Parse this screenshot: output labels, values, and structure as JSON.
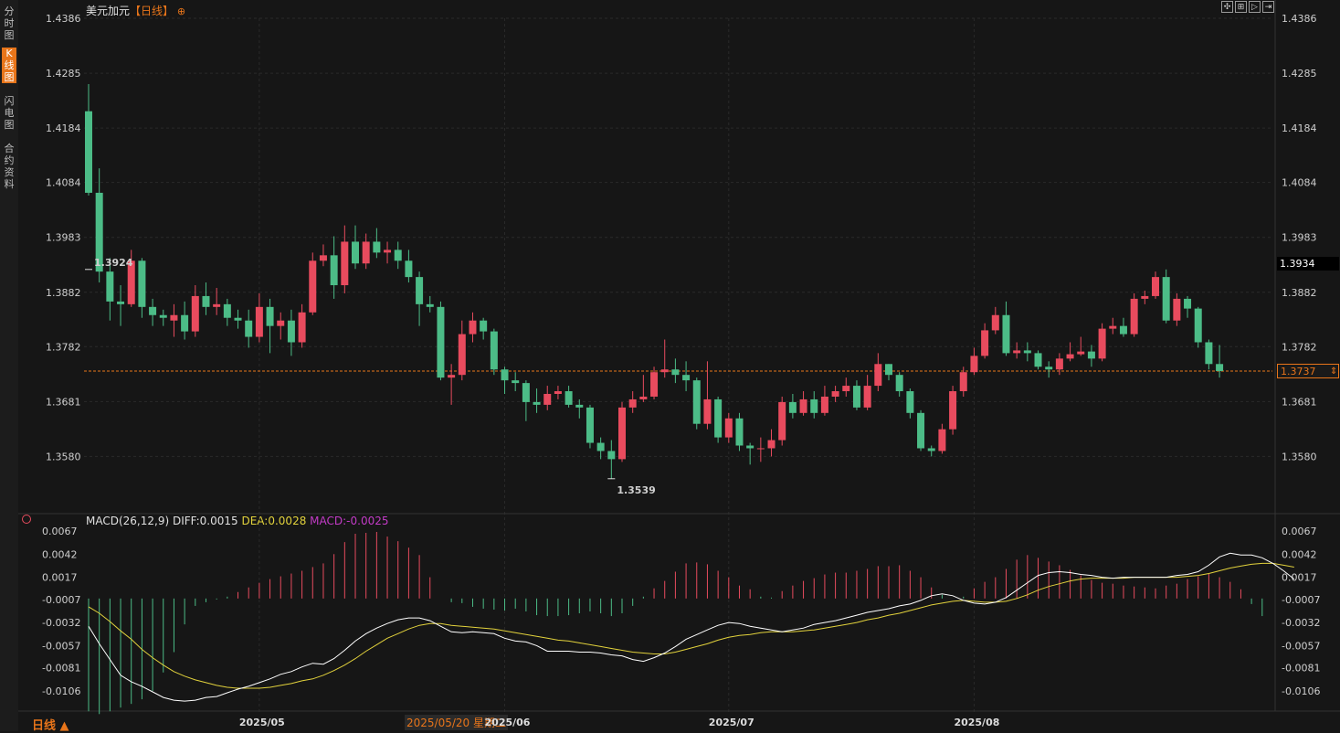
{
  "sidebar": {
    "tabs": [
      {
        "label": "分时图",
        "active": false
      },
      {
        "label": "K线图",
        "active": true
      },
      {
        "label": "闪电图",
        "active": false
      },
      {
        "label": "合约资料",
        "active": false
      }
    ]
  },
  "header": {
    "symbol": "美元加元",
    "period": "【日线】",
    "gear_icon": "settings-gear-icon"
  },
  "toolbar": {
    "buttons": [
      {
        "name": "crosshair-button",
        "icon": "crosshair-icon"
      },
      {
        "name": "zoom-button",
        "icon": "zoom-icon"
      },
      {
        "name": "play-button",
        "icon": "play-icon"
      },
      {
        "name": "next-button",
        "icon": "next-icon"
      }
    ]
  },
  "colors": {
    "up": "#e84b5e",
    "down": "#4cbc87",
    "last_line": "#e8751a",
    "diff": "#ffffff",
    "dea": "#e2d23c",
    "macd_label": "#c33bc7"
  },
  "price_axis": {
    "ticks": [
      "1.4386",
      "1.4285",
      "1.4184",
      "1.4084",
      "1.3983",
      "1.3882",
      "1.3782",
      "1.3681",
      "1.3580"
    ],
    "min": 1.35,
    "max": 1.4386
  },
  "markers": {
    "high_label": "1.3924",
    "high_value": 1.3924,
    "low_label": "1.3539",
    "low_value": 1.3539,
    "cursor_price": "1.3934",
    "last_price": "1.3737"
  },
  "macd": {
    "title": "MACD(26,12,9)",
    "diff_label": "DIFF:0.0015",
    "dea_label": "DEA:0.0028",
    "macd_label": "MACD:-0.0025",
    "axis_ticks": [
      "0.0067",
      "0.0042",
      "0.0017",
      "-0.0007",
      "-0.0032",
      "-0.0057",
      "-0.0081",
      "-0.0106"
    ],
    "min": -0.0118,
    "max": 0.0067
  },
  "x_axis": {
    "labels": [
      {
        "text": "2025/05",
        "index": 16
      },
      {
        "text": "2025/06",
        "index": 39
      },
      {
        "text": "2025/07",
        "index": 60
      },
      {
        "text": "2025/08",
        "index": 83
      }
    ],
    "cursor_date": "2025/05/20 星期二",
    "period_button": "日线 ▲"
  },
  "chart_data": {
    "type": "candlestick",
    "candles": [
      [
        1.4215,
        1.4065,
        1.4265,
        1.406
      ],
      [
        1.4065,
        1.392,
        1.411,
        1.39
      ],
      [
        1.392,
        1.3865,
        1.3945,
        1.383
      ],
      [
        1.3865,
        1.386,
        1.3895,
        1.382
      ],
      [
        1.386,
        1.394,
        1.396,
        1.3855
      ],
      [
        1.394,
        1.3855,
        1.3945,
        1.3835
      ],
      [
        1.3855,
        1.384,
        1.387,
        1.382
      ],
      [
        1.384,
        1.3835,
        1.385,
        1.382
      ],
      [
        1.383,
        1.384,
        1.386,
        1.38
      ],
      [
        1.384,
        1.381,
        1.3865,
        1.3795
      ],
      [
        1.381,
        1.3875,
        1.3895,
        1.38
      ],
      [
        1.3875,
        1.3855,
        1.39,
        1.384
      ],
      [
        1.3855,
        1.386,
        1.389,
        1.384
      ],
      [
        1.386,
        1.3835,
        1.387,
        1.382
      ],
      [
        1.3835,
        1.383,
        1.385,
        1.3815
      ],
      [
        1.383,
        1.38,
        1.385,
        1.378
      ],
      [
        1.38,
        1.3855,
        1.388,
        1.379
      ],
      [
        1.3855,
        1.382,
        1.387,
        1.377
      ],
      [
        1.382,
        1.383,
        1.3845,
        1.3795
      ],
      [
        1.383,
        1.379,
        1.385,
        1.3765
      ],
      [
        1.379,
        1.3845,
        1.386,
        1.378
      ],
      [
        1.3845,
        1.394,
        1.3955,
        1.384
      ],
      [
        1.394,
        1.395,
        1.397,
        1.393
      ],
      [
        1.395,
        1.3895,
        1.3985,
        1.387
      ],
      [
        1.3895,
        1.3975,
        1.4005,
        1.388
      ],
      [
        1.3975,
        1.3935,
        1.4005,
        1.3925
      ],
      [
        1.3935,
        1.3975,
        1.399,
        1.3925
      ],
      [
        1.3975,
        1.3955,
        1.4,
        1.3945
      ],
      [
        1.3955,
        1.396,
        1.3975,
        1.3935
      ],
      [
        1.396,
        1.394,
        1.3975,
        1.3925
      ],
      [
        1.394,
        1.391,
        1.396,
        1.39
      ],
      [
        1.391,
        1.386,
        1.392,
        1.382
      ],
      [
        1.386,
        1.3855,
        1.3875,
        1.3845
      ],
      [
        1.3855,
        1.3725,
        1.3865,
        1.372
      ],
      [
        1.3725,
        1.373,
        1.375,
        1.3675
      ],
      [
        1.373,
        1.3805,
        1.383,
        1.372
      ],
      [
        1.3805,
        1.383,
        1.3845,
        1.379
      ],
      [
        1.383,
        1.381,
        1.3835,
        1.3795
      ],
      [
        1.381,
        1.374,
        1.3815,
        1.373
      ],
      [
        1.374,
        1.372,
        1.3745,
        1.3695
      ],
      [
        1.372,
        1.3715,
        1.3735,
        1.37
      ],
      [
        1.3715,
        1.368,
        1.372,
        1.3645
      ],
      [
        1.368,
        1.3675,
        1.3705,
        1.366
      ],
      [
        1.3675,
        1.3695,
        1.371,
        1.3665
      ],
      [
        1.3695,
        1.37,
        1.371,
        1.3685
      ],
      [
        1.37,
        1.3675,
        1.371,
        1.367
      ],
      [
        1.3675,
        1.367,
        1.3685,
        1.365
      ],
      [
        1.367,
        1.3605,
        1.3675,
        1.3595
      ],
      [
        1.3605,
        1.359,
        1.3615,
        1.3575
      ],
      [
        1.359,
        1.3575,
        1.361,
        1.3539
      ],
      [
        1.3575,
        1.367,
        1.368,
        1.357
      ],
      [
        1.367,
        1.3685,
        1.37,
        1.366
      ],
      [
        1.3685,
        1.369,
        1.373,
        1.368
      ],
      [
        1.369,
        1.3735,
        1.3745,
        1.3685
      ],
      [
        1.3735,
        1.374,
        1.3795,
        1.3725
      ],
      [
        1.374,
        1.373,
        1.376,
        1.3715
      ],
      [
        1.373,
        1.372,
        1.3755,
        1.37
      ],
      [
        1.372,
        1.364,
        1.3725,
        1.363
      ],
      [
        1.364,
        1.3685,
        1.3755,
        1.363
      ],
      [
        1.3685,
        1.3615,
        1.369,
        1.3605
      ],
      [
        1.3615,
        1.365,
        1.366,
        1.3605
      ],
      [
        1.365,
        1.36,
        1.366,
        1.359
      ],
      [
        1.36,
        1.3595,
        1.3605,
        1.3565
      ],
      [
        1.3595,
        1.3595,
        1.3615,
        1.357
      ],
      [
        1.3595,
        1.361,
        1.363,
        1.358
      ],
      [
        1.361,
        1.368,
        1.369,
        1.36
      ],
      [
        1.368,
        1.366,
        1.3695,
        1.365
      ],
      [
        1.366,
        1.3685,
        1.37,
        1.3655
      ],
      [
        1.3685,
        1.366,
        1.37,
        1.365
      ],
      [
        1.366,
        1.369,
        1.371,
        1.3655
      ],
      [
        1.369,
        1.37,
        1.371,
        1.368
      ],
      [
        1.37,
        1.371,
        1.3725,
        1.369
      ],
      [
        1.371,
        1.367,
        1.372,
        1.3665
      ],
      [
        1.367,
        1.371,
        1.373,
        1.3665
      ],
      [
        1.371,
        1.375,
        1.377,
        1.37
      ],
      [
        1.375,
        1.373,
        1.375,
        1.372
      ],
      [
        1.373,
        1.37,
        1.3735,
        1.369
      ],
      [
        1.37,
        1.366,
        1.3705,
        1.365
      ],
      [
        1.366,
        1.3595,
        1.3665,
        1.359
      ],
      [
        1.3595,
        1.359,
        1.36,
        1.358
      ],
      [
        1.359,
        1.363,
        1.364,
        1.3585
      ],
      [
        1.363,
        1.37,
        1.371,
        1.362
      ],
      [
        1.37,
        1.3735,
        1.3745,
        1.369
      ],
      [
        1.3735,
        1.3765,
        1.378,
        1.373
      ],
      [
        1.3765,
        1.3812,
        1.3825,
        1.376
      ],
      [
        1.3812,
        1.384,
        1.3855,
        1.3805
      ],
      [
        1.384,
        1.377,
        1.3865,
        1.3765
      ],
      [
        1.377,
        1.3775,
        1.379,
        1.376
      ],
      [
        1.3775,
        1.377,
        1.379,
        1.3755
      ],
      [
        1.377,
        1.3745,
        1.3775,
        1.374
      ],
      [
        1.3745,
        1.374,
        1.3755,
        1.3725
      ],
      [
        1.374,
        1.376,
        1.377,
        1.373
      ],
      [
        1.376,
        1.3768,
        1.379,
        1.3755
      ],
      [
        1.3768,
        1.3773,
        1.38,
        1.3765
      ],
      [
        1.3773,
        1.376,
        1.3785,
        1.3745
      ],
      [
        1.376,
        1.3815,
        1.3825,
        1.3755
      ],
      [
        1.3815,
        1.382,
        1.3835,
        1.3805
      ],
      [
        1.382,
        1.3805,
        1.3835,
        1.38
      ],
      [
        1.3805,
        1.387,
        1.388,
        1.38
      ],
      [
        1.387,
        1.3875,
        1.3885,
        1.386
      ],
      [
        1.3875,
        1.391,
        1.392,
        1.387
      ],
      [
        1.391,
        1.383,
        1.3924,
        1.3825
      ],
      [
        1.383,
        1.387,
        1.388,
        1.382
      ],
      [
        1.387,
        1.3852,
        1.3875,
        1.3835
      ],
      [
        1.3852,
        1.379,
        1.3855,
        1.378
      ],
      [
        1.379,
        1.375,
        1.3795,
        1.374
      ],
      [
        1.375,
        1.3737,
        1.3785,
        1.3725
      ]
    ],
    "macd_hist": [
      -0.0128,
      -0.0131,
      -0.0128,
      -0.0124,
      -0.012,
      -0.0115,
      -0.0106,
      -0.0086,
      -0.0064,
      -0.0034,
      -0.0014,
      -0.001,
      -0.0007,
      -0.0004,
      0.0001,
      0.0006,
      0.0011,
      0.0015,
      0.0018,
      0.0021,
      0.0024,
      0.0028,
      0.0032,
      0.0042,
      0.0055,
      0.0064,
      0.0065,
      0.0066,
      0.0061,
      0.0056,
      0.0049,
      0.0041,
      0.0017,
      -0.0006,
      -0.001,
      -0.0011,
      -0.0015,
      -0.0017,
      -0.0018,
      -0.0019,
      -0.0017,
      -0.002,
      -0.0024,
      -0.0025,
      -0.0025,
      -0.0024,
      -0.0022,
      -0.002,
      -0.0022,
      -0.0025,
      -0.0022,
      -0.0014,
      -0.0004,
      0.0005,
      0.0013,
      0.0023,
      0.0032,
      0.0033,
      0.0031,
      0.0024,
      0.0017,
      0.0008,
      0.0004,
      -0.0004,
      -0.0005,
      0.0002,
      0.0008,
      0.0013,
      0.0016,
      0.002,
      0.0022,
      0.0022,
      0.0024,
      0.0026,
      0.0029,
      0.0029,
      0.003,
      0.0024,
      0.0017,
      0.0006,
      -0.0002,
      -0.0006,
      -0.0004,
      0.0005,
      0.0012,
      0.0017,
      0.0026,
      0.0036,
      0.0041,
      0.0038,
      0.0034,
      0.003,
      0.0025,
      0.0019,
      0.0014,
      0.0011,
      0.001,
      0.0008,
      0.0007,
      0.0006,
      0.0005,
      0.0008,
      0.001,
      0.0015,
      0.0018,
      0.0021,
      0.0017,
      0.0012,
      0.0004,
      -0.0012,
      -0.0025
    ],
    "diff": [
      -0.0036,
      -0.0055,
      -0.0072,
      -0.0089,
      -0.0096,
      -0.0101,
      -0.0107,
      -0.0113,
      -0.0116,
      -0.0117,
      -0.0116,
      -0.0113,
      -0.0112,
      -0.0108,
      -0.0104,
      -0.0101,
      -0.0097,
      -0.0093,
      -0.0088,
      -0.0085,
      -0.008,
      -0.0076,
      -0.0077,
      -0.0071,
      -0.0062,
      -0.0052,
      -0.0044,
      -0.0038,
      -0.0033,
      -0.0029,
      -0.0027,
      -0.0027,
      -0.003,
      -0.0036,
      -0.0042,
      -0.0043,
      -0.0042,
      -0.0043,
      -0.0044,
      -0.0049,
      -0.0052,
      -0.0053,
      -0.0057,
      -0.0063,
      -0.0063,
      -0.0063,
      -0.0064,
      -0.0064,
      -0.0065,
      -0.0067,
      -0.0068,
      -0.0072,
      -0.0074,
      -0.007,
      -0.0065,
      -0.0058,
      -0.005,
      -0.0045,
      -0.004,
      -0.0035,
      -0.0032,
      -0.0033,
      -0.0036,
      -0.0038,
      -0.004,
      -0.0042,
      -0.004,
      -0.0038,
      -0.0034,
      -0.0032,
      -0.003,
      -0.0027,
      -0.0024,
      -0.0021,
      -0.0019,
      -0.0017,
      -0.0014,
      -0.0012,
      -0.0008,
      -0.0003,
      -0.0001,
      -0.0003,
      -0.0008,
      -0.0011,
      -0.0012,
      -0.001,
      -0.0005,
      0.0003,
      0.0011,
      0.0019,
      0.0022,
      0.0023,
      0.0022,
      0.002,
      0.0019,
      0.0017,
      0.0016,
      0.0017,
      0.0017,
      0.0017,
      0.0017,
      0.0017,
      0.0019,
      0.002,
      0.0023,
      0.003,
      0.0039,
      0.0043,
      0.0041,
      0.0041,
      0.0038,
      0.0032,
      0.0024,
      0.0015
    ],
    "dea": [
      -0.0015,
      -0.0022,
      -0.0031,
      -0.0041,
      -0.005,
      -0.0061,
      -0.007,
      -0.0078,
      -0.0085,
      -0.009,
      -0.0094,
      -0.0097,
      -0.01,
      -0.0102,
      -0.0103,
      -0.0103,
      -0.0103,
      -0.0102,
      -0.01,
      -0.0098,
      -0.0095,
      -0.0093,
      -0.0089,
      -0.0084,
      -0.0078,
      -0.0071,
      -0.0063,
      -0.0056,
      -0.0049,
      -0.0044,
      -0.0039,
      -0.0035,
      -0.0033,
      -0.0033,
      -0.0035,
      -0.0036,
      -0.0037,
      -0.0038,
      -0.0039,
      -0.0041,
      -0.0043,
      -0.0045,
      -0.0047,
      -0.0049,
      -0.0051,
      -0.0052,
      -0.0054,
      -0.0056,
      -0.0058,
      -0.006,
      -0.0062,
      -0.0064,
      -0.0065,
      -0.0066,
      -0.0066,
      -0.0064,
      -0.0061,
      -0.0058,
      -0.0055,
      -0.0051,
      -0.0048,
      -0.0046,
      -0.0045,
      -0.0043,
      -0.0042,
      -0.0042,
      -0.0042,
      -0.0041,
      -0.004,
      -0.0038,
      -0.0036,
      -0.0034,
      -0.0032,
      -0.0029,
      -0.0027,
      -0.0024,
      -0.0022,
      -0.0019,
      -0.0016,
      -0.0013,
      -0.0011,
      -0.0009,
      -0.0008,
      -0.0009,
      -0.001,
      -0.001,
      -0.0009,
      -0.0006,
      -0.0002,
      0.0003,
      0.0007,
      0.001,
      0.0013,
      0.0015,
      0.0016,
      0.0016,
      0.0016,
      0.0016,
      0.0017,
      0.0017,
      0.0017,
      0.0017,
      0.0017,
      0.0018,
      0.0019,
      0.0021,
      0.0024,
      0.0027,
      0.0029,
      0.0031,
      0.0032,
      0.0032,
      0.003,
      0.0028
    ]
  }
}
